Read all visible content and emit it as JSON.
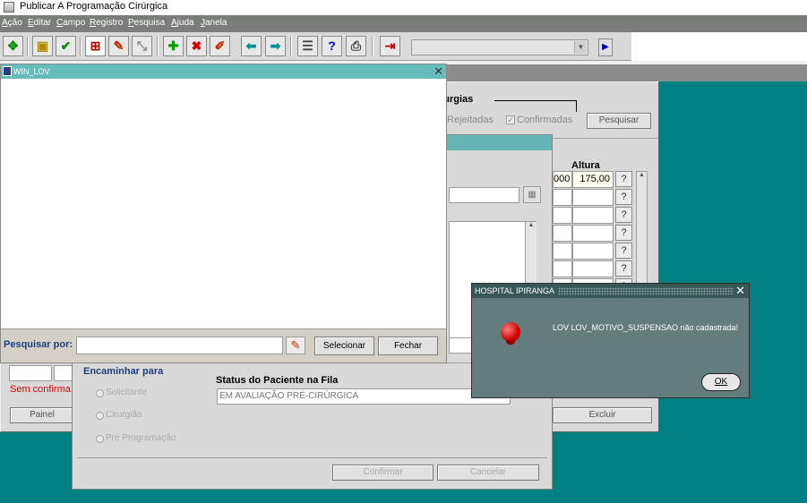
{
  "app": {
    "window_title": "Publicar A Programação Cirúrgica"
  },
  "menu": [
    "Ação",
    "Editar",
    "Campo",
    "Registro",
    "Pesquisa",
    "Ajuda",
    "Janela"
  ],
  "main": {
    "section_title": "rurgias",
    "filter_rejeitadas": "Rejeitadas",
    "filter_confirmadas": "Confirmadas",
    "search_button": "Pesquisar",
    "col_altura": "Altura",
    "first_row_left_value": "000",
    "first_row_altura": "175,00",
    "status_text": "Sem confirma",
    "panel_button": "Painel",
    "delete_button": "Excluir"
  },
  "middle_dialog": {
    "encaminhar_title": "Encaminhar para",
    "radio_solicitante": "Solicitante",
    "radio_cirurgiao": "Cirurgião",
    "radio_preprog": "Pré Programação",
    "status_label": "Status do Paciente na Fila",
    "status_value": "EM AVALIAÇÃO PRÉ-CIRÚRGICA",
    "confirm_button": "Confirmar",
    "cancel_button": "Cancelar"
  },
  "win_lov": {
    "title": "WIN_LOV",
    "search_label": "Pesquisar por:",
    "search_value": "",
    "select_button": "Selecionar",
    "close_button": "Fechar"
  },
  "alert": {
    "title": "HOSPITAL IPIRANGA",
    "message": "LOV LOV_MOTIVO_SUSPENSAO não cadastrada!",
    "ok_button": "OK"
  }
}
